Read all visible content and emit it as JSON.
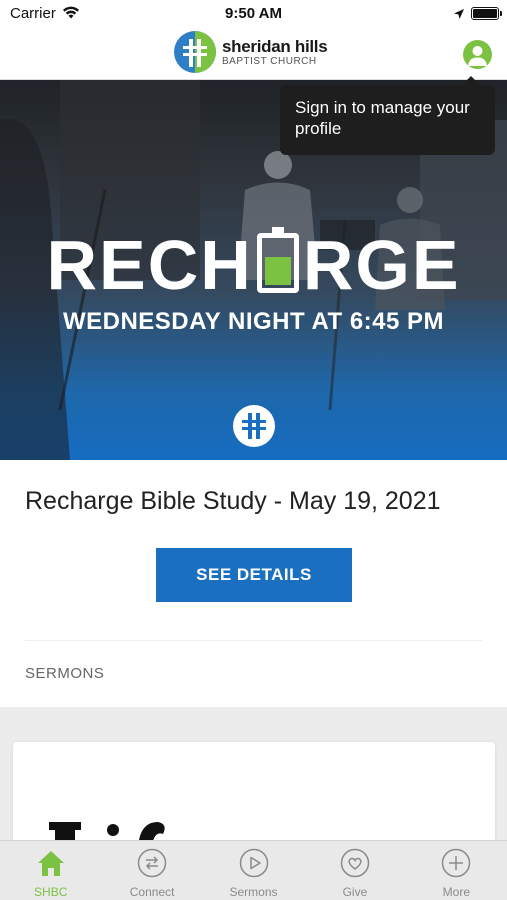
{
  "status_bar": {
    "carrier": "Carrier",
    "time": "9:50 AM"
  },
  "header": {
    "logo_line1": "sheridan hills",
    "logo_line2": "BAPTIST CHURCH",
    "tooltip": "Sign in to manage your profile"
  },
  "hero": {
    "title_left": "RECH",
    "title_right": "RGE",
    "subtitle": "WEDNESDAY NIGHT AT 6:45 PM"
  },
  "event": {
    "title": "Recharge Bible Study - May 19, 2021",
    "button_label": "SEE DETAILS"
  },
  "section": {
    "label": "SERMONS"
  },
  "tabs": [
    {
      "label": "SHBC",
      "icon": "home-icon",
      "active": true
    },
    {
      "label": "Connect",
      "icon": "connect-icon",
      "active": false
    },
    {
      "label": "Sermons",
      "icon": "play-icon",
      "active": false
    },
    {
      "label": "Give",
      "icon": "heart-icon",
      "active": false
    },
    {
      "label": "More",
      "icon": "plus-icon",
      "active": false
    }
  ],
  "colors": {
    "brand_green": "#7cc242",
    "brand_blue": "#1a6fc0"
  }
}
